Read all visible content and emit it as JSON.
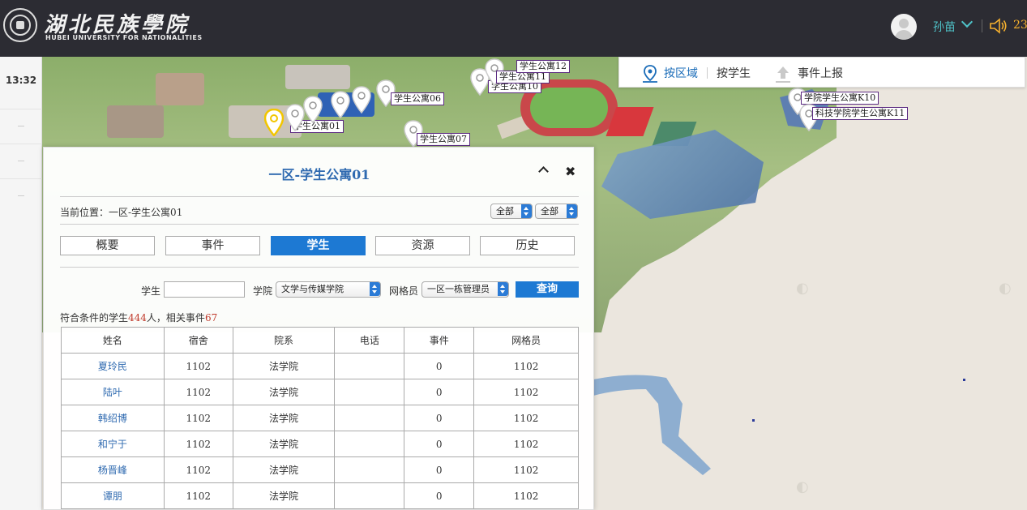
{
  "header": {
    "logo_cn": "湖北民族學院",
    "logo_en": "HUBEI UNIVERSITY FOR NATIONALITIES",
    "username": "孙苗",
    "notify_count": "23"
  },
  "leftnav": {
    "time": "13:32"
  },
  "map_tools": {
    "by_area": "按区域",
    "by_student": "按学生",
    "report_event": "事件上报"
  },
  "markers": [
    "学生公寓01",
    "学生公寓06",
    "学生公寓07",
    "学生公寓10",
    "学生公寓11",
    "学生公寓12",
    "学院学生公寓K10",
    "科技学院学生公寓K11"
  ],
  "panel": {
    "title": "一区-学生公寓01",
    "current_location": "当前位置：一区-学生公寓01",
    "filter1": "全部",
    "filter2": "全部",
    "tabs": [
      "概要",
      "事件",
      "学生",
      "资源",
      "历史"
    ],
    "active_tab": 2,
    "form": {
      "student_label": "学生",
      "student_value": "",
      "college_label": "学院",
      "college_value": "文学与传媒学院",
      "grid_label": "网格员",
      "grid_value": "一区一栋管理员",
      "query_label": "查询"
    },
    "summary": {
      "prefix": "符合条件的学生",
      "count": "444",
      "mid": "人，相关事件",
      "events": "67"
    },
    "table": {
      "headers": [
        "姓名",
        "宿舍",
        "院系",
        "电话",
        "事件",
        "网格员"
      ],
      "rows": [
        [
          "夏玲民",
          "1102",
          "法学院",
          "",
          "0",
          "1102"
        ],
        [
          "陆叶",
          "1102",
          "法学院",
          "",
          "0",
          "1102"
        ],
        [
          "韩绍博",
          "1102",
          "法学院",
          "",
          "0",
          "1102"
        ],
        [
          "和宁于",
          "1102",
          "法学院",
          "",
          "0",
          "1102"
        ],
        [
          "杨晋峰",
          "1102",
          "法学院",
          "",
          "0",
          "1102"
        ],
        [
          "谭朋",
          "1102",
          "法学院",
          "",
          "0",
          "1102"
        ]
      ]
    }
  },
  "colors": {
    "header_bg": "#2c2c33",
    "accent_blue": "#1d79d3",
    "teal": "#4fc3c9",
    "orange": "#f5b02e",
    "highlight_red": "#c0392b"
  }
}
